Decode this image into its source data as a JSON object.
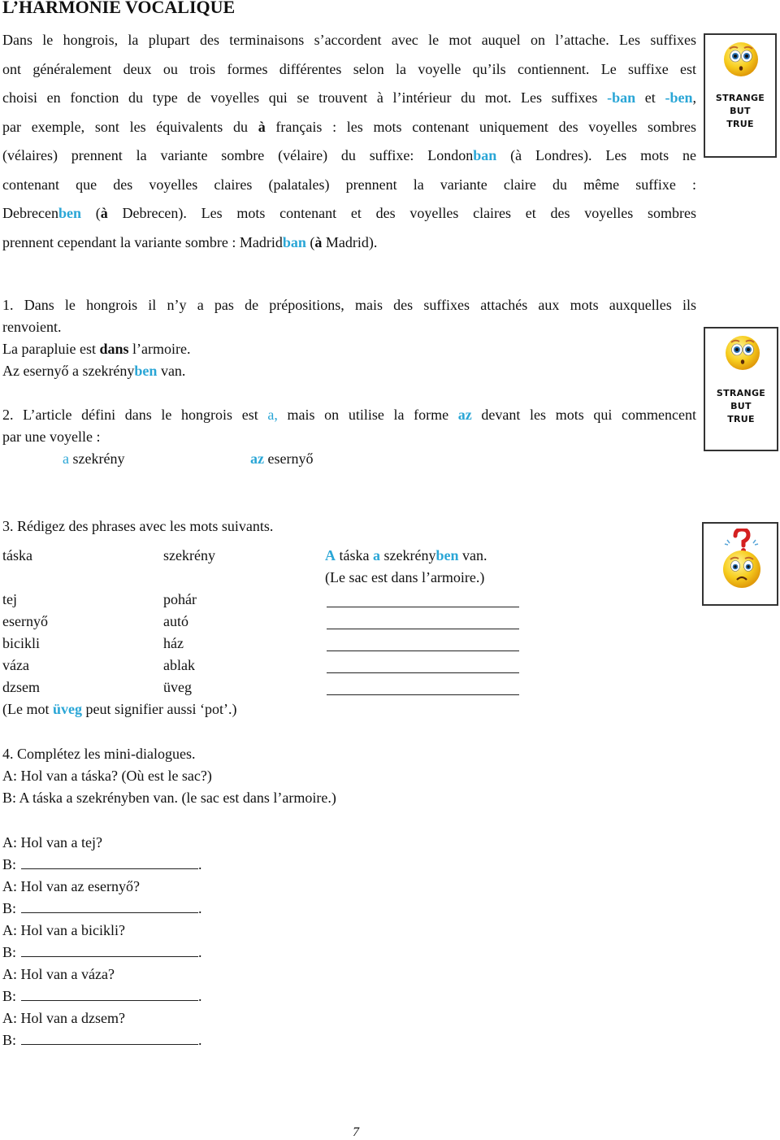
{
  "title": "L’HARMONIE VOCALIQUE",
  "intro": {
    "lines": [
      {
        "segments": [
          {
            "t": "Dans le hongrois, la plupart des terminaisons s’accordent avec le mot auquel on l’attache. Les suffixes"
          }
        ]
      },
      {
        "segments": [
          {
            "t": "ont généralement deux ou trois formes différentes selon la voyelle qu’ils contiennent. Le suffixe est"
          }
        ]
      },
      {
        "segments": [
          {
            "t": "choisi en fonction du type de voyelles qui se trouvent à l’intérieur du mot. Les suffixes "
          },
          {
            "t": "-ban",
            "hl": true
          },
          {
            "t": " et "
          },
          {
            "t": "-ben",
            "hl": true
          },
          {
            "t": ","
          }
        ]
      },
      {
        "segments": [
          {
            "t": "par exemple, sont les équivalents du "
          },
          {
            "t": "à",
            "b": true
          },
          {
            "t": " français : les mots contenant uniquement des voyelles sombres"
          }
        ]
      },
      {
        "segments": [
          {
            "t": "(vélaires) prennent la variante sombre (vélaire) du suffixe: London"
          },
          {
            "t": "ban",
            "hl": true
          },
          {
            "t": " (à Londres). Les mots ne"
          }
        ]
      },
      {
        "segments": [
          {
            "t": "contenant que des voyelles claires (palatales) prennent la variante claire du même suffixe :"
          }
        ]
      },
      {
        "segments": [
          {
            "t": "Debrecen"
          },
          {
            "t": "ben",
            "hl": true
          },
          {
            "t": " ("
          },
          {
            "t": "à",
            "b": true
          },
          {
            "t": " Debrecen). Les mots contenant et des voyelles claires et des voyelles sombres"
          }
        ]
      },
      {
        "segments": [
          {
            "t": "prennent cependant la variante sombre : Madrid"
          },
          {
            "t": "ban",
            "hl": true
          },
          {
            "t": " ("
          },
          {
            "t": "à",
            "b": true
          },
          {
            "t": " Madrid)."
          }
        ]
      }
    ]
  },
  "badges": [
    {
      "icon": "surprised-face-icon",
      "caption": [
        "STRANGE",
        "BUT",
        "TRUE"
      ]
    },
    {
      "icon": "surprised-face-icon",
      "caption": [
        "STRANGE",
        "BUT",
        "TRUE"
      ]
    },
    {
      "icon": "confused-face-question-icon",
      "caption": []
    }
  ],
  "section1": {
    "line1": "1. Dans le hongrois il n’y a pas de prépositions, mais des suffixes attachés aux mots auxquelles ils",
    "line2": "renvoient.",
    "ex_fr_pre": "La parapluie est ",
    "ex_fr_bold": "dans",
    "ex_fr_post": " l’armoire.",
    "ex_hu_pre": "Az esernyő a szekrény",
    "ex_hu_hl": "ben",
    "ex_hu_post": " van."
  },
  "section2": {
    "line1_pre": "2. L’article défini dans le hongrois est ",
    "line1_a": "a,",
    "line1_mid": " mais on utilise la forme ",
    "line1_az": "az",
    "line1_post": " devant les mots qui commencent",
    "line2": "par une voyelle :",
    "ex1_art": "a",
    "ex1_word": " szekrény",
    "ex2_art": "az",
    "ex2_word": " esernyő"
  },
  "section3": {
    "heading": "3. Rédigez des phrases avec les mots suivants.",
    "example": {
      "w1": "táska",
      "w2": "szekrény",
      "s_a": "A",
      "s_1": " táska ",
      "s_a2": "a",
      "s_2": " szekrény",
      "s_ben": "ben",
      "s_3": " van.",
      "translation": "(Le sac est dans l’armoire.)"
    },
    "rows": [
      {
        "w1": "tej",
        "w2": "pohár"
      },
      {
        "w1": "esernyő",
        "w2": "autó"
      },
      {
        "w1": "bicikli",
        "w2": "ház"
      },
      {
        "w1": "váza",
        "w2": "ablak"
      },
      {
        "w1": "dzsem",
        "w2": "üveg"
      }
    ],
    "note_pre": "(Le mot ",
    "note_hl": "üveg",
    "note_post": " peut signifier aussi ‘pot’.)"
  },
  "section4": {
    "heading": "4. Complétez les mini-dialogues.",
    "example_a": "A: Hol van a táska? (Où est le sac?)",
    "example_b": "B: A táska a szekrényben van. (le sac est dans l’armoire.)",
    "b_prefix": "B:",
    "b_suffix": ".",
    "questions": [
      "A: Hol van a tej?",
      "A: Hol van az esernyő?",
      "A: Hol van a bicikli?",
      "A: Hol van a váza?",
      "A: Hol van a dzsem?"
    ]
  },
  "page_number": "7",
  "colors": {
    "accent": "#2aa6d6",
    "text": "#111111"
  }
}
